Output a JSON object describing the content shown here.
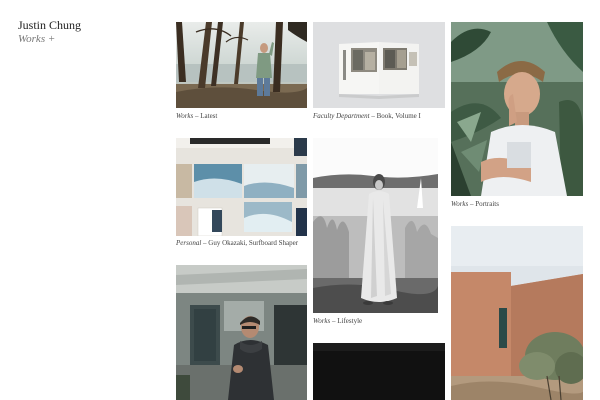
{
  "header": {
    "name": "Justin Chung",
    "nav_label": "Works +"
  },
  "grid": [
    {
      "id": "c1",
      "category": "Works",
      "sep": " – ",
      "title": "Latest"
    },
    {
      "id": "c2",
      "category": "Personal",
      "sep": " – ",
      "title": "Guy Okazaki, Surfboard Shaper"
    },
    {
      "id": "c3"
    },
    {
      "id": "c4",
      "category": "Faculty Department",
      "sep": " – ",
      "title": "Book, Volume I"
    },
    {
      "id": "c5",
      "category": "Works",
      "sep": " – ",
      "title": "Lifestyle"
    },
    {
      "id": "c6"
    },
    {
      "id": "c7",
      "category": "Works",
      "sep": " – ",
      "title": "Portraits"
    },
    {
      "id": "c8"
    }
  ],
  "colors": {
    "background": "#ffffff",
    "text": "#222222",
    "muted": "#777777"
  }
}
